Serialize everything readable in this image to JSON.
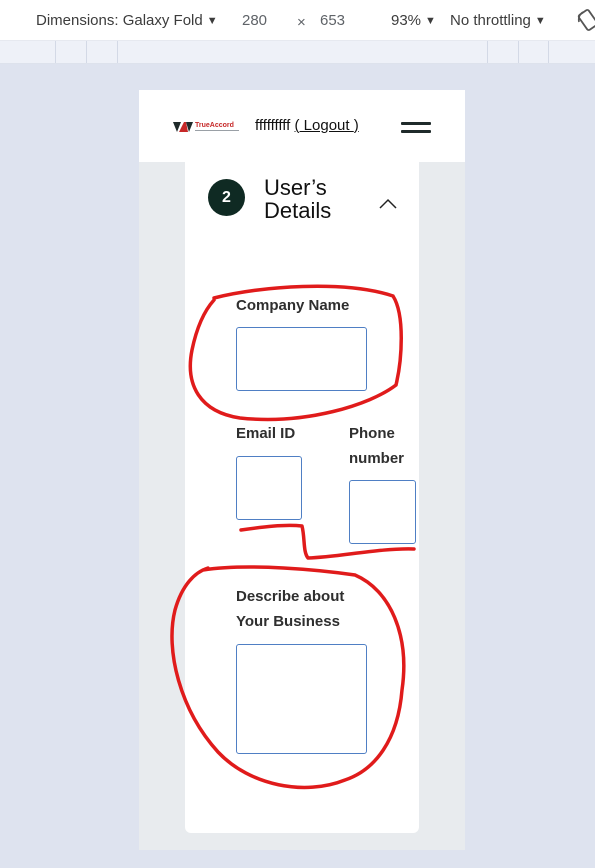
{
  "devtools": {
    "dimensions_label": "Dimensions: Galaxy Fold",
    "width": "280",
    "times": "×",
    "height": "653",
    "zoom": "93%",
    "throttling": "No throttling"
  },
  "header": {
    "logo_text": "TrueAccord",
    "username": "fffffffff",
    "logout_open": "(",
    "logout_label": " Logout ",
    "logout_close": ")"
  },
  "section": {
    "step_number": "2",
    "title": "User’s Details"
  },
  "form": {
    "company_name_label": "Company Name",
    "company_name_value": "",
    "email_label": "Email ID",
    "email_value": "",
    "phone_label_line1": "Phone",
    "phone_label_line2": "number",
    "phone_value": "",
    "business_label_line1": "Describe about",
    "business_label_line2": "Your Business",
    "business_value": ""
  },
  "colors": {
    "annotation": "#e01b1b",
    "input_border": "#4f7fc4",
    "step_circle": "#0f2a23"
  }
}
